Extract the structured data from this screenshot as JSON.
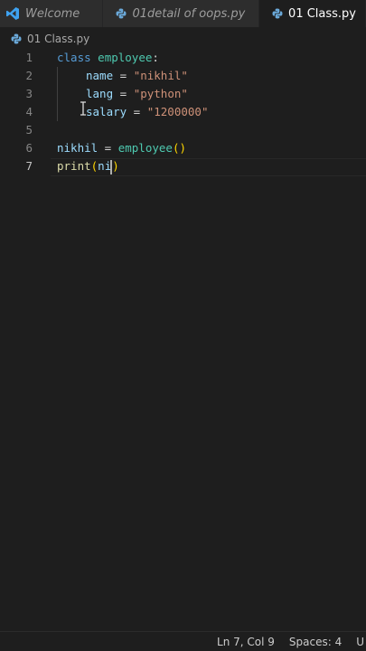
{
  "tabs": [
    {
      "label": "Welcome",
      "icon": "vscode-icon",
      "active": false
    },
    {
      "label": "01detail of oops.py",
      "icon": "python-icon",
      "active": false
    },
    {
      "label": "01 Class.py",
      "icon": "python-icon",
      "active": true
    }
  ],
  "breadcrumb": {
    "file": "01 Class.py",
    "icon": "python-icon"
  },
  "editor": {
    "lines": [
      {
        "n": "1",
        "tokens": [
          "class",
          "employee",
          ":"
        ]
      },
      {
        "n": "2",
        "tokens": [
          "name",
          " = ",
          "\"nikhil\""
        ]
      },
      {
        "n": "3",
        "tokens": [
          "lang",
          " = ",
          "\"python\""
        ]
      },
      {
        "n": "4",
        "tokens": [
          "salary",
          " = ",
          "\"1200000\""
        ]
      },
      {
        "n": "5",
        "tokens": []
      },
      {
        "n": "6",
        "tokens": [
          "nikhil",
          " = ",
          "employee",
          "()"
        ]
      },
      {
        "n": "7",
        "tokens": [
          "print",
          "(",
          "ni",
          ")"
        ]
      }
    ],
    "current_line": 7
  },
  "status": {
    "position": "Ln 7, Col 9",
    "spaces": "Spaces: 4",
    "overflow": "U"
  },
  "colors": {
    "keyword": "#569cd6",
    "class": "#4ec9b0",
    "string": "#ce9178",
    "function": "#dcdcaa",
    "bracket": "#ffd700"
  }
}
